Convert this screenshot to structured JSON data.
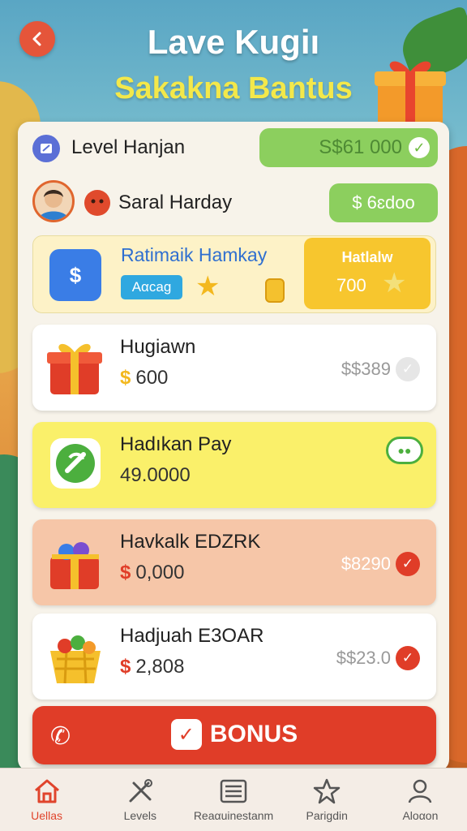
{
  "header": {
    "title": "Lave Kugiı",
    "subtitle": "Sakakna Bantus"
  },
  "level": {
    "label": "Level Hanjan",
    "amount": "S$61 000"
  },
  "user": {
    "name": "Saral Harday",
    "amount": "$ 6ɛdoo"
  },
  "promo": {
    "title": "Ratimaik Hamkay",
    "tag": "Aαcag",
    "box_label": "Hatlalw",
    "box_value": "700"
  },
  "rewards": [
    {
      "name": "Hugiawn",
      "currency": "$",
      "amount": "600",
      "price": "$$389"
    },
    {
      "name": "Hadıkan Pay",
      "currency": "",
      "amount": "49.0000",
      "price": ""
    },
    {
      "name": "Havkalk EDZRK",
      "currency": "$",
      "amount": "0,000",
      "price": "$8290"
    },
    {
      "name": "Hadjuah E3OAR",
      "currency": "$",
      "amount": "2,808",
      "price": "$$23.0"
    }
  ],
  "bonus": {
    "label": "BONUS"
  },
  "tabs": [
    {
      "label": "Uellas",
      "icon": "home-icon"
    },
    {
      "label": "Levels",
      "icon": "tools-icon"
    },
    {
      "label": "Reaαuinestanm",
      "icon": "list-icon"
    },
    {
      "label": "Parigdin",
      "icon": "star-icon"
    },
    {
      "label": "Aloαon",
      "icon": "user-icon"
    }
  ],
  "colors": {
    "accent_red": "#e03d28",
    "accent_green": "#8ccf5e",
    "accent_yellow": "#f7c62e"
  }
}
